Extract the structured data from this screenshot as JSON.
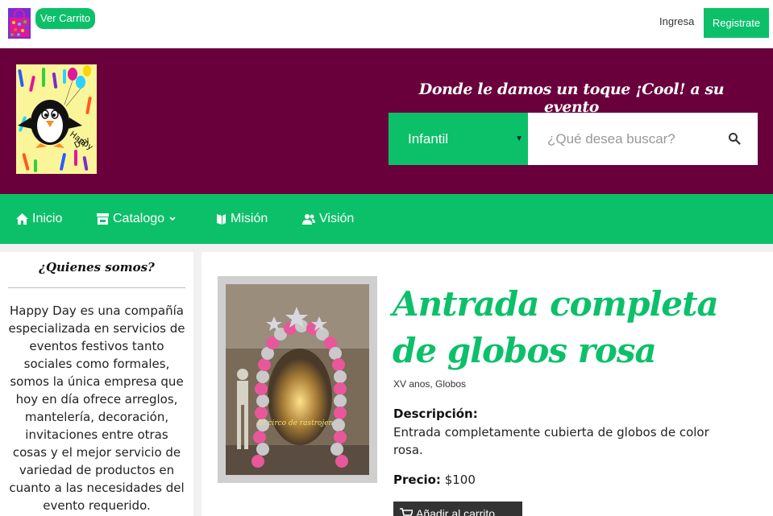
{
  "topbar": {
    "cart_label": "Ver Carrito",
    "login_label": "Ingresa",
    "register_label": "Registrate"
  },
  "header": {
    "logo_text": "Happy Day",
    "tagline": "Donde le damos un toque ¡Cool! a su evento",
    "category_selected": "Infantil",
    "search_placeholder": "¿Qué desea buscar?"
  },
  "nav": {
    "items": [
      {
        "label": "Inicio",
        "icon": "home-icon"
      },
      {
        "label": "Catalogo",
        "icon": "store-icon"
      },
      {
        "label": "Misión",
        "icon": "book-icon"
      },
      {
        "label": "Visión",
        "icon": "users-icon"
      }
    ]
  },
  "sidebar": {
    "title": "¿Quienes somos?",
    "brand": "Happy Day",
    "text": " es una compañía especializada en servicios de eventos festivos tanto sociales como formales, somos la única empresa que hoy en día ofrece arreglos, mantelería, decoración, invitaciones entre otras cosas y el mejor servicio de variedad de productos en cuanto a las necesidades del evento requerido."
  },
  "product": {
    "title": "Antrada completa de globos rosa",
    "tags": "XV anos, Globos",
    "desc_label": "Descripción:",
    "description": "Entrada completamente cubierta de globos de color rosa.",
    "price_label": "Precio:",
    "price": "$100",
    "add_label": "Añadir al carrito",
    "photo_caption": "El circo de rastrojen"
  },
  "colors": {
    "accent": "#0cc06a",
    "header_bg": "#69003c"
  }
}
